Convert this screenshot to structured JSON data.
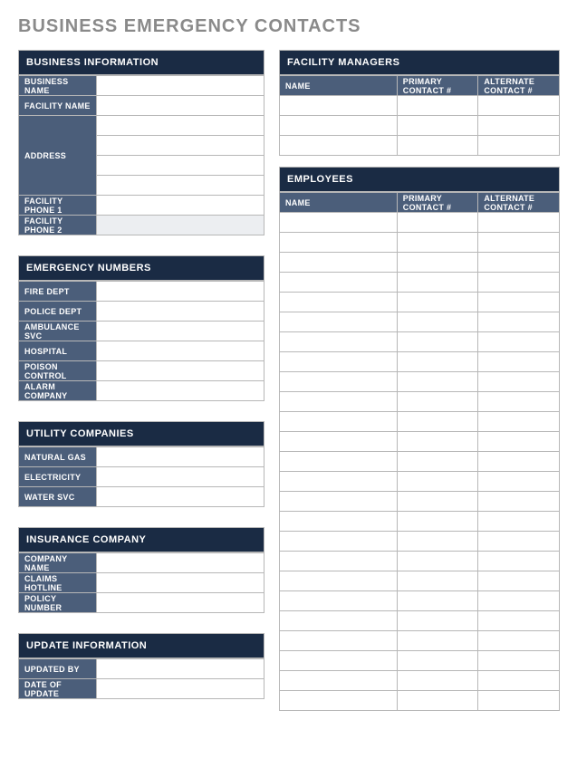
{
  "title": "BUSINESS EMERGENCY CONTACTS",
  "businessInfo": {
    "header": "BUSINESS INFORMATION",
    "labels": {
      "businessName": "BUSINESS NAME",
      "facilityName": "FACILITY NAME",
      "address": "ADDRESS",
      "phone1": "FACILITY PHONE 1",
      "phone2": "FACILITY PHONE 2"
    },
    "values": {
      "businessName": "",
      "facilityName": "",
      "address1": "",
      "address2": "",
      "address3": "",
      "address4": "",
      "phone1": "",
      "phone2": ""
    }
  },
  "emergencyNumbers": {
    "header": "EMERGENCY NUMBERS",
    "rows": [
      {
        "label": "FIRE DEPT",
        "value": ""
      },
      {
        "label": "POLICE DEPT",
        "value": ""
      },
      {
        "label": "AMBULANCE SVC",
        "value": ""
      },
      {
        "label": "HOSPITAL",
        "value": ""
      },
      {
        "label": "POISON CONTROL",
        "value": ""
      },
      {
        "label": "ALARM COMPANY",
        "value": ""
      }
    ]
  },
  "utilityCompanies": {
    "header": "UTILITY COMPANIES",
    "rows": [
      {
        "label": "NATURAL GAS",
        "value": ""
      },
      {
        "label": "ELECTRICITY",
        "value": ""
      },
      {
        "label": "WATER SVC",
        "value": ""
      }
    ]
  },
  "insurance": {
    "header": "INSURANCE COMPANY",
    "rows": [
      {
        "label": "COMPANY NAME",
        "value": ""
      },
      {
        "label": "CLAIMS HOTLINE",
        "value": ""
      },
      {
        "label": "POLICY NUMBER",
        "value": ""
      }
    ]
  },
  "updateInfo": {
    "header": "UPDATE INFORMATION",
    "rows": [
      {
        "label": "UPDATED BY",
        "value": ""
      },
      {
        "label": "DATE OF UPDATE",
        "value": ""
      }
    ]
  },
  "facilityManagers": {
    "header": "FACILITY MANAGERS",
    "columns": {
      "name": "NAME",
      "primary": "PRIMARY CONTACT #",
      "alternate": "ALTERNATE CONTACT #"
    },
    "rows": [
      {
        "name": "",
        "primary": "",
        "alternate": ""
      },
      {
        "name": "",
        "primary": "",
        "alternate": ""
      },
      {
        "name": "",
        "primary": "",
        "alternate": ""
      }
    ]
  },
  "employees": {
    "header": "EMPLOYEES",
    "columns": {
      "name": "NAME",
      "primary": "PRIMARY CONTACT #",
      "alternate": "ALTERNATE CONTACT #"
    },
    "rows": [
      {
        "name": "",
        "primary": "",
        "alternate": ""
      },
      {
        "name": "",
        "primary": "",
        "alternate": ""
      },
      {
        "name": "",
        "primary": "",
        "alternate": ""
      },
      {
        "name": "",
        "primary": "",
        "alternate": ""
      },
      {
        "name": "",
        "primary": "",
        "alternate": ""
      },
      {
        "name": "",
        "primary": "",
        "alternate": ""
      },
      {
        "name": "",
        "primary": "",
        "alternate": ""
      },
      {
        "name": "",
        "primary": "",
        "alternate": ""
      },
      {
        "name": "",
        "primary": "",
        "alternate": ""
      },
      {
        "name": "",
        "primary": "",
        "alternate": ""
      },
      {
        "name": "",
        "primary": "",
        "alternate": ""
      },
      {
        "name": "",
        "primary": "",
        "alternate": ""
      },
      {
        "name": "",
        "primary": "",
        "alternate": ""
      },
      {
        "name": "",
        "primary": "",
        "alternate": ""
      },
      {
        "name": "",
        "primary": "",
        "alternate": ""
      },
      {
        "name": "",
        "primary": "",
        "alternate": ""
      },
      {
        "name": "",
        "primary": "",
        "alternate": ""
      },
      {
        "name": "",
        "primary": "",
        "alternate": ""
      },
      {
        "name": "",
        "primary": "",
        "alternate": ""
      },
      {
        "name": "",
        "primary": "",
        "alternate": ""
      },
      {
        "name": "",
        "primary": "",
        "alternate": ""
      },
      {
        "name": "",
        "primary": "",
        "alternate": ""
      },
      {
        "name": "",
        "primary": "",
        "alternate": ""
      },
      {
        "name": "",
        "primary": "",
        "alternate": ""
      },
      {
        "name": "",
        "primary": "",
        "alternate": ""
      }
    ]
  }
}
